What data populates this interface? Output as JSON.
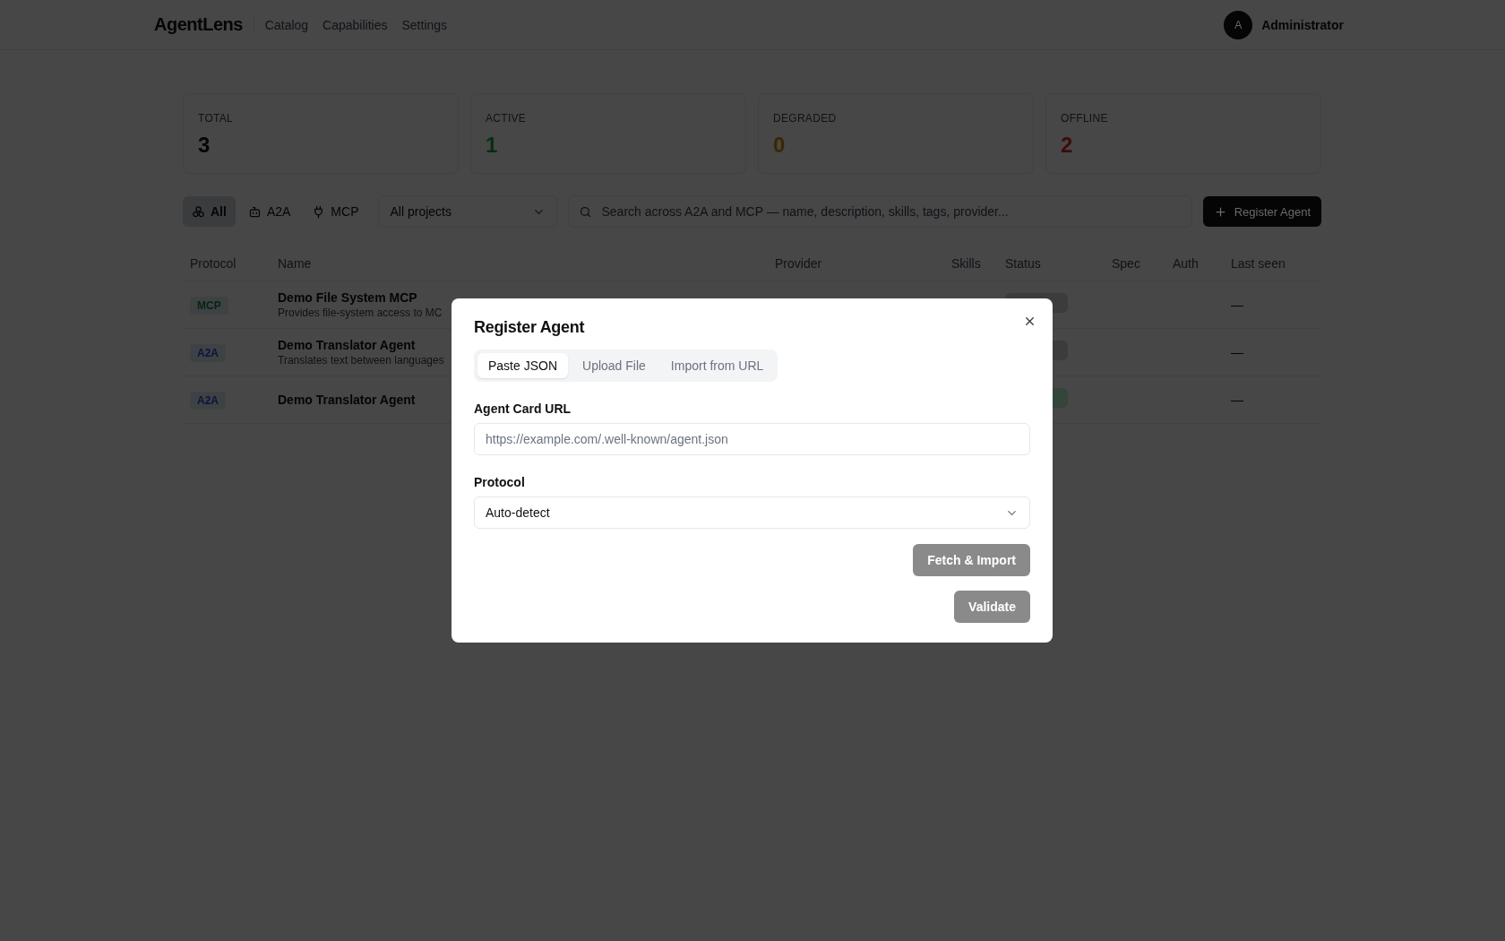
{
  "header": {
    "logo": "AgentLens",
    "nav": [
      {
        "label": "Catalog"
      },
      {
        "label": "Capabilities"
      },
      {
        "label": "Settings"
      }
    ],
    "user": {
      "initial": "A",
      "name": "Administrator"
    }
  },
  "stats": [
    {
      "label": "TOTAL",
      "value": "3",
      "color": "#050505"
    },
    {
      "label": "ACTIVE",
      "value": "1",
      "color": "#062e15"
    },
    {
      "label": "DEGRADED",
      "value": "0",
      "color": "#392701"
    },
    {
      "label": "OFFLINE",
      "value": "2",
      "color": "#3e0b0b"
    }
  ],
  "filters": {
    "protocols": [
      {
        "label": "All",
        "kind": "all",
        "selected": true
      },
      {
        "label": "A2A",
        "kind": "a2a",
        "selected": false
      },
      {
        "label": "MCP",
        "kind": "mcp",
        "selected": false
      }
    ],
    "project": "All projects",
    "search_placeholder": "Search across A2A and MCP — name, description, skills, tags, provider...",
    "register_button": "Register Agent"
  },
  "table": {
    "columns": [
      "Protocol",
      "Name",
      "Provider",
      "Skills",
      "Status",
      "Spec",
      "Auth",
      "Last seen"
    ],
    "rows": [
      {
        "protocol": {
          "label": "MCP",
          "color": "#062411"
        },
        "name": "Demo File System MCP",
        "description": "Provides file-system access to MC",
        "status": {
          "color": "#3b3c3d"
        },
        "last_seen": "—"
      },
      {
        "protocol": {
          "label": "A2A",
          "color": "#08163c"
        },
        "name": "Demo Translator Agent",
        "description": "Translates text between languages",
        "status": {
          "color": "#3b3c3d"
        },
        "last_seen": "—"
      },
      {
        "protocol": {
          "label": "A2A",
          "color": "#08163c"
        },
        "name": "Demo Translator Agent",
        "status": {
          "color": "#34453a"
        },
        "last_seen": "—"
      }
    ]
  },
  "modal": {
    "title": "Register Agent",
    "tabs": [
      {
        "label": "Paste JSON",
        "selected": true
      },
      {
        "label": "Upload File",
        "selected": false
      },
      {
        "label": "Import from URL",
        "selected": false
      }
    ],
    "url_label": "Agent Card URL",
    "url_placeholder": "https://example.com/.well-known/agent.json",
    "protocol_label": "Protocol",
    "protocol_value": "Auto-detect",
    "fetch_button": {
      "label": "Fetch & Import",
      "disabled": true
    },
    "validate_button": {
      "label": "Validate",
      "disabled": true
    }
  }
}
